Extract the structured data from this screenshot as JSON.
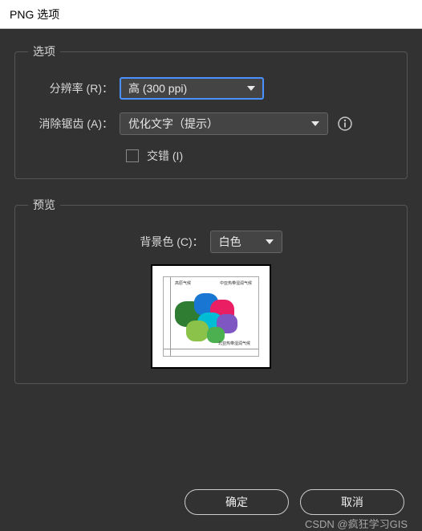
{
  "titlebar": {
    "title": "PNG 选项"
  },
  "options_group": {
    "legend": "选项",
    "resolution_label": "分辨率 (R)：",
    "resolution_value": "高 (300 ppi)",
    "antialias_label": "消除锯齿 (A)：",
    "antialias_value": "优化文字（提示）",
    "interlace_label": "交错 (I)"
  },
  "preview_group": {
    "legend": "预览",
    "bgcolor_label": "背景色 (C)：",
    "bgcolor_value": "白色"
  },
  "buttons": {
    "ok": "确定",
    "cancel": "取消"
  },
  "watermark": "CSDN @疯狂学习GIS"
}
